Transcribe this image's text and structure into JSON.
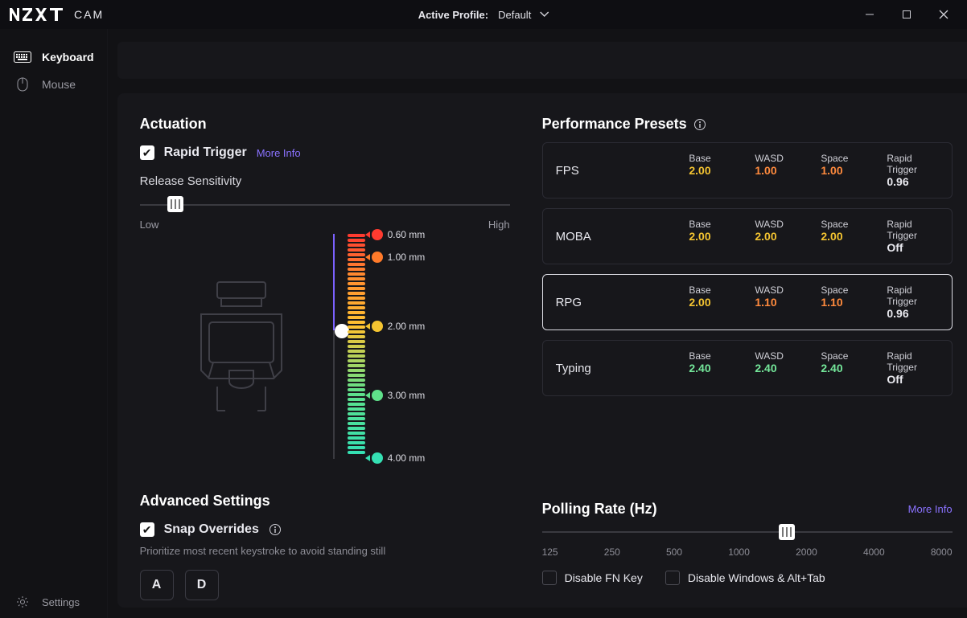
{
  "header": {
    "subtitle": "CAM",
    "activeProfileLabel": "Active Profile:",
    "activeProfile": "Default"
  },
  "sidebar": {
    "items": [
      {
        "label": "Keyboard",
        "active": true
      },
      {
        "label": "Mouse",
        "active": false
      }
    ],
    "settings": "Settings"
  },
  "actuation": {
    "title": "Actuation",
    "rapidTrigger": {
      "label": "Rapid Trigger",
      "moreInfo": "More Info",
      "checked": true
    },
    "releaseSensitivity": {
      "label": "Release Sensitivity",
      "low": "Low",
      "high": "High"
    },
    "depthMarks": [
      "0.60 mm",
      "1.00 mm",
      "2.00 mm",
      "3.00 mm",
      "4.00 mm"
    ]
  },
  "advanced": {
    "title": "Advanced Settings",
    "snap": {
      "label": "Snap Overrides",
      "checked": true,
      "hint": "Prioritize most recent keystroke to avoid standing still",
      "keys": [
        "A",
        "D"
      ]
    }
  },
  "presets": {
    "title": "Performance Presets",
    "columns": [
      "Base",
      "WASD",
      "Space",
      "Rapid Trigger"
    ],
    "items": [
      {
        "name": "FPS",
        "selected": false,
        "values": [
          {
            "v": "2.00",
            "c": "yellow"
          },
          {
            "v": "1.00",
            "c": "orange"
          },
          {
            "v": "1.00",
            "c": "orange"
          },
          {
            "v": "0.96",
            "c": "white"
          }
        ]
      },
      {
        "name": "MOBA",
        "selected": false,
        "values": [
          {
            "v": "2.00",
            "c": "yellow"
          },
          {
            "v": "2.00",
            "c": "yellow"
          },
          {
            "v": "2.00",
            "c": "yellow"
          },
          {
            "v": "Off",
            "c": "white"
          }
        ]
      },
      {
        "name": "RPG",
        "selected": true,
        "values": [
          {
            "v": "2.00",
            "c": "yellow"
          },
          {
            "v": "1.10",
            "c": "orange"
          },
          {
            "v": "1.10",
            "c": "orange"
          },
          {
            "v": "0.96",
            "c": "white"
          }
        ]
      },
      {
        "name": "Typing",
        "selected": false,
        "values": [
          {
            "v": "2.40",
            "c": "green"
          },
          {
            "v": "2.40",
            "c": "green"
          },
          {
            "v": "2.40",
            "c": "green"
          },
          {
            "v": "Off",
            "c": "white"
          }
        ]
      }
    ]
  },
  "polling": {
    "title": "Polling Rate (Hz)",
    "moreInfo": "More Info",
    "ticks": [
      "125",
      "250",
      "500",
      "1000",
      "2000",
      "4000",
      "8000"
    ],
    "selected": "2000",
    "toggles": [
      "Disable FN Key",
      "Disable Windows & Alt+Tab"
    ]
  }
}
